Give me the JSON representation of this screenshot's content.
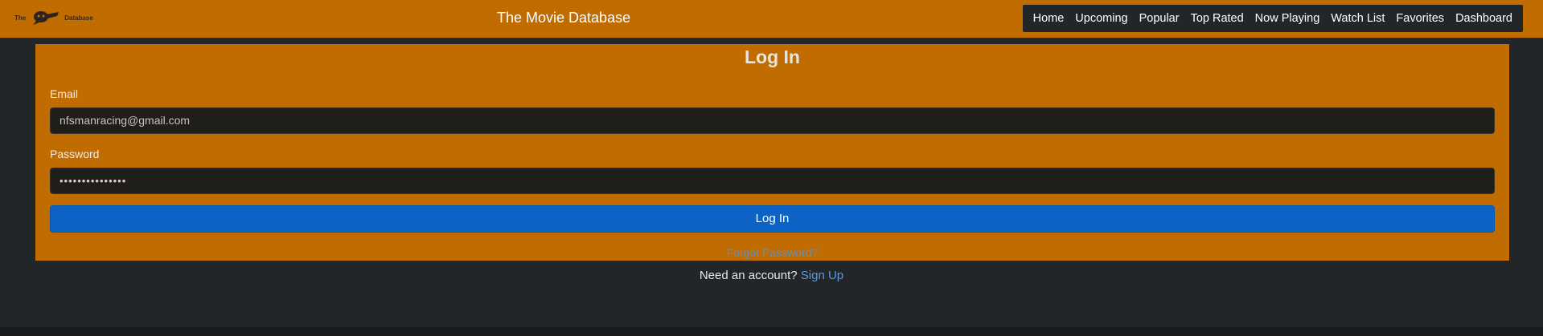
{
  "navbar": {
    "logo_text_left": "The",
    "logo_text_right": "Database",
    "brand": "The Movie Database",
    "links": [
      {
        "label": "Home"
      },
      {
        "label": "Upcoming"
      },
      {
        "label": "Popular"
      },
      {
        "label": "Top Rated"
      },
      {
        "label": "Now Playing"
      },
      {
        "label": "Watch List"
      },
      {
        "label": "Favorites"
      },
      {
        "label": "Dashboard"
      }
    ]
  },
  "login": {
    "title": "Log In",
    "email_label": "Email",
    "email_value": "nfsmanracing@gmail.com",
    "password_label": "Password",
    "password_value": "•••••••••••••••",
    "submit_label": "Log In",
    "forgot_label": "Forgot Password?"
  },
  "signup": {
    "prompt": "Need an account?",
    "link_label": "Sign Up"
  },
  "colors": {
    "brand_orange": "#c06c00",
    "dark_background": "#222628",
    "primary_blue": "#0d62c6",
    "link_blue": "#5b9ae0"
  }
}
